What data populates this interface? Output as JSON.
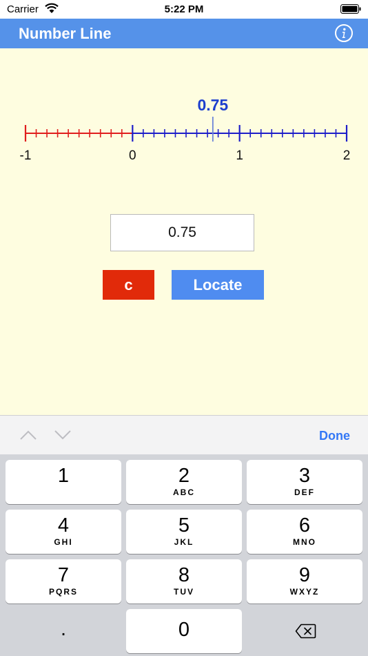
{
  "status_bar": {
    "carrier": "Carrier",
    "time": "5:22 PM"
  },
  "nav": {
    "title": "Number Line",
    "info_icon": "info-icon"
  },
  "number_line": {
    "min": -1,
    "max": 2,
    "subdivisions_per_unit": 10,
    "tick_labels": [
      "-1",
      "0",
      "1",
      "2"
    ],
    "marker_value": 0.75,
    "marker_label": "0.75",
    "colors": {
      "negative": "#e01d1d",
      "positive": "#1d1dc9",
      "marker": "#1d3fce"
    }
  },
  "input": {
    "value": "0.75"
  },
  "buttons": {
    "clear_label": "c",
    "locate_label": "Locate"
  },
  "accessory": {
    "done_label": "Done"
  },
  "keypad": {
    "keys": [
      {
        "digit": "1",
        "letters": ""
      },
      {
        "digit": "2",
        "letters": "ABC"
      },
      {
        "digit": "3",
        "letters": "DEF"
      },
      {
        "digit": "4",
        "letters": "GHI"
      },
      {
        "digit": "5",
        "letters": "JKL"
      },
      {
        "digit": "6",
        "letters": "MNO"
      },
      {
        "digit": "7",
        "letters": "PQRS"
      },
      {
        "digit": "8",
        "letters": "TUV"
      },
      {
        "digit": "9",
        "letters": "WXYZ"
      }
    ],
    "dot": ".",
    "zero": "0"
  }
}
